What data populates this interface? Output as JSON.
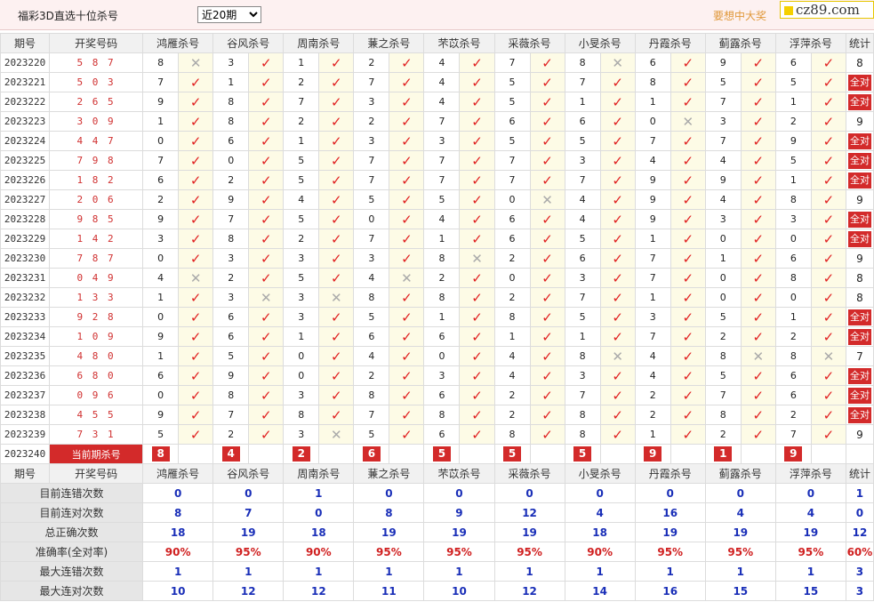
{
  "header": {
    "title": "福彩3D直选十位杀号",
    "period_selected": "近20期",
    "slogan": "要想中大奖",
    "logo_text": "cz89.com"
  },
  "columns": {
    "period": "期号",
    "draw": "开奖号码",
    "stat": "统计",
    "methods": [
      "鸿雁杀号",
      "谷风杀号",
      "周南杀号",
      "蒹之杀号",
      "芣苡杀号",
      "采薇杀号",
      "小旻杀号",
      "丹霞杀号",
      "蓟露杀号",
      "浮萍杀号"
    ]
  },
  "rows": [
    {
      "period": "2023220",
      "draw": "5 8 7",
      "kills": [
        8,
        3,
        1,
        2,
        4,
        7,
        8,
        6,
        9,
        6
      ],
      "hits": [
        0,
        1,
        1,
        1,
        1,
        1,
        0,
        1,
        1,
        1
      ],
      "stat": "8"
    },
    {
      "period": "2023221",
      "draw": "5 0 3",
      "kills": [
        7,
        1,
        2,
        7,
        4,
        5,
        7,
        8,
        5,
        5
      ],
      "hits": [
        1,
        1,
        1,
        1,
        1,
        1,
        1,
        1,
        1,
        1
      ],
      "stat": "全对"
    },
    {
      "period": "2023222",
      "draw": "2 6 5",
      "kills": [
        9,
        8,
        7,
        3,
        4,
        5,
        1,
        1,
        7,
        1
      ],
      "hits": [
        1,
        1,
        1,
        1,
        1,
        1,
        1,
        1,
        1,
        1
      ],
      "stat": "全对"
    },
    {
      "period": "2023223",
      "draw": "3 0 9",
      "kills": [
        1,
        8,
        2,
        2,
        7,
        6,
        6,
        0,
        3,
        2
      ],
      "hits": [
        1,
        1,
        1,
        1,
        1,
        1,
        1,
        0,
        1,
        1
      ],
      "stat": "9"
    },
    {
      "period": "2023224",
      "draw": "4 4 7",
      "kills": [
        0,
        6,
        1,
        3,
        3,
        5,
        5,
        7,
        7,
        9
      ],
      "hits": [
        1,
        1,
        1,
        1,
        1,
        1,
        1,
        1,
        1,
        1
      ],
      "stat": "全对"
    },
    {
      "period": "2023225",
      "draw": "7 9 8",
      "kills": [
        7,
        0,
        5,
        7,
        7,
        7,
        3,
        4,
        4,
        5
      ],
      "hits": [
        1,
        1,
        1,
        1,
        1,
        1,
        1,
        1,
        1,
        1
      ],
      "stat": "全对"
    },
    {
      "period": "2023226",
      "draw": "1 8 2",
      "kills": [
        6,
        2,
        5,
        7,
        7,
        7,
        7,
        9,
        9,
        1
      ],
      "hits": [
        1,
        1,
        1,
        1,
        1,
        1,
        1,
        1,
        1,
        1
      ],
      "stat": "全对"
    },
    {
      "period": "2023227",
      "draw": "2 0 6",
      "kills": [
        2,
        9,
        4,
        5,
        5,
        0,
        4,
        9,
        4,
        8
      ],
      "hits": [
        1,
        1,
        1,
        1,
        1,
        0,
        1,
        1,
        1,
        1
      ],
      "stat": "9"
    },
    {
      "period": "2023228",
      "draw": "9 8 5",
      "kills": [
        9,
        7,
        5,
        0,
        4,
        6,
        4,
        9,
        3,
        3
      ],
      "hits": [
        1,
        1,
        1,
        1,
        1,
        1,
        1,
        1,
        1,
        1
      ],
      "stat": "全对"
    },
    {
      "period": "2023229",
      "draw": "1 4 2",
      "kills": [
        3,
        8,
        2,
        7,
        1,
        6,
        5,
        1,
        0,
        0
      ],
      "hits": [
        1,
        1,
        1,
        1,
        1,
        1,
        1,
        1,
        1,
        1
      ],
      "stat": "全对"
    },
    {
      "period": "2023230",
      "draw": "7 8 7",
      "kills": [
        0,
        3,
        3,
        3,
        8,
        2,
        6,
        7,
        1,
        6
      ],
      "hits": [
        1,
        1,
        1,
        1,
        0,
        1,
        1,
        1,
        1,
        1
      ],
      "stat": "9"
    },
    {
      "period": "2023231",
      "draw": "0 4 9",
      "kills": [
        4,
        2,
        5,
        4,
        2,
        0,
        3,
        7,
        0,
        8
      ],
      "hits": [
        0,
        1,
        1,
        0,
        1,
        1,
        1,
        1,
        1,
        1
      ],
      "stat": "8"
    },
    {
      "period": "2023232",
      "draw": "1 3 3",
      "kills": [
        1,
        3,
        3,
        8,
        8,
        2,
        7,
        1,
        0,
        0
      ],
      "hits": [
        1,
        0,
        0,
        1,
        1,
        1,
        1,
        1,
        1,
        1
      ],
      "stat": "8"
    },
    {
      "period": "2023233",
      "draw": "9 2 8",
      "kills": [
        0,
        6,
        3,
        5,
        1,
        8,
        5,
        3,
        5,
        1
      ],
      "hits": [
        1,
        1,
        1,
        1,
        1,
        1,
        1,
        1,
        1,
        1
      ],
      "stat": "全对"
    },
    {
      "period": "2023234",
      "draw": "1 0 9",
      "kills": [
        9,
        6,
        1,
        6,
        6,
        1,
        1,
        7,
        2,
        2
      ],
      "hits": [
        1,
        1,
        1,
        1,
        1,
        1,
        1,
        1,
        1,
        1
      ],
      "stat": "全对"
    },
    {
      "period": "2023235",
      "draw": "4 8 0",
      "kills": [
        1,
        5,
        0,
        4,
        0,
        4,
        8,
        4,
        8,
        8
      ],
      "hits": [
        1,
        1,
        1,
        1,
        1,
        1,
        0,
        1,
        0,
        0
      ],
      "stat": "7"
    },
    {
      "period": "2023236",
      "draw": "6 8 0",
      "kills": [
        6,
        9,
        0,
        2,
        3,
        4,
        3,
        4,
        5,
        6
      ],
      "hits": [
        1,
        1,
        1,
        1,
        1,
        1,
        1,
        1,
        1,
        1
      ],
      "stat": "全对"
    },
    {
      "period": "2023237",
      "draw": "0 9 6",
      "kills": [
        0,
        8,
        3,
        8,
        6,
        2,
        7,
        2,
        7,
        6
      ],
      "hits": [
        1,
        1,
        1,
        1,
        1,
        1,
        1,
        1,
        1,
        1
      ],
      "stat": "全对"
    },
    {
      "period": "2023238",
      "draw": "4 5 5",
      "kills": [
        9,
        7,
        8,
        7,
        8,
        2,
        8,
        2,
        8,
        2
      ],
      "hits": [
        1,
        1,
        1,
        1,
        1,
        1,
        1,
        1,
        1,
        1
      ],
      "stat": "全对"
    },
    {
      "period": "2023239",
      "draw": "7 3 1",
      "kills": [
        5,
        2,
        3,
        5,
        6,
        8,
        8,
        1,
        2,
        7
      ],
      "hits": [
        1,
        1,
        0,
        1,
        1,
        1,
        1,
        1,
        1,
        1
      ],
      "stat": "9"
    }
  ],
  "current": {
    "period": "2023240",
    "label": "当前期杀号",
    "kills": [
      8,
      4,
      2,
      6,
      5,
      5,
      5,
      9,
      1,
      9
    ]
  },
  "stats": [
    {
      "label": "目前连错次数",
      "values": [
        0,
        0,
        1,
        0,
        0,
        0,
        0,
        0,
        0,
        0
      ],
      "total": "1",
      "color": "blue"
    },
    {
      "label": "目前连对次数",
      "values": [
        8,
        7,
        0,
        8,
        9,
        12,
        4,
        16,
        4,
        4
      ],
      "total": "0",
      "color": "blue"
    },
    {
      "label": "总正确次数",
      "values": [
        18,
        19,
        18,
        19,
        19,
        19,
        18,
        19,
        19,
        19
      ],
      "total": "12",
      "color": "blue"
    },
    {
      "label": "准确率(全对率)",
      "values": [
        "90%",
        "95%",
        "90%",
        "95%",
        "95%",
        "95%",
        "90%",
        "95%",
        "95%",
        "95%"
      ],
      "total": "60%",
      "color": "red"
    },
    {
      "label": "最大连错次数",
      "values": [
        1,
        1,
        1,
        1,
        1,
        1,
        1,
        1,
        1,
        1
      ],
      "total": "3",
      "color": "blue"
    },
    {
      "label": "最大连对次数",
      "values": [
        10,
        12,
        12,
        11,
        10,
        12,
        14,
        16,
        15,
        15
      ],
      "total": "3",
      "color": "blue"
    }
  ],
  "symbols": {
    "hit": "✓",
    "miss": "✕"
  },
  "colors": {
    "hit": "#e02020",
    "miss": "#aaaaaa",
    "badge": "#d32a2a",
    "stat_blue": "#1a2fb8",
    "stat_red": "#d02020"
  }
}
